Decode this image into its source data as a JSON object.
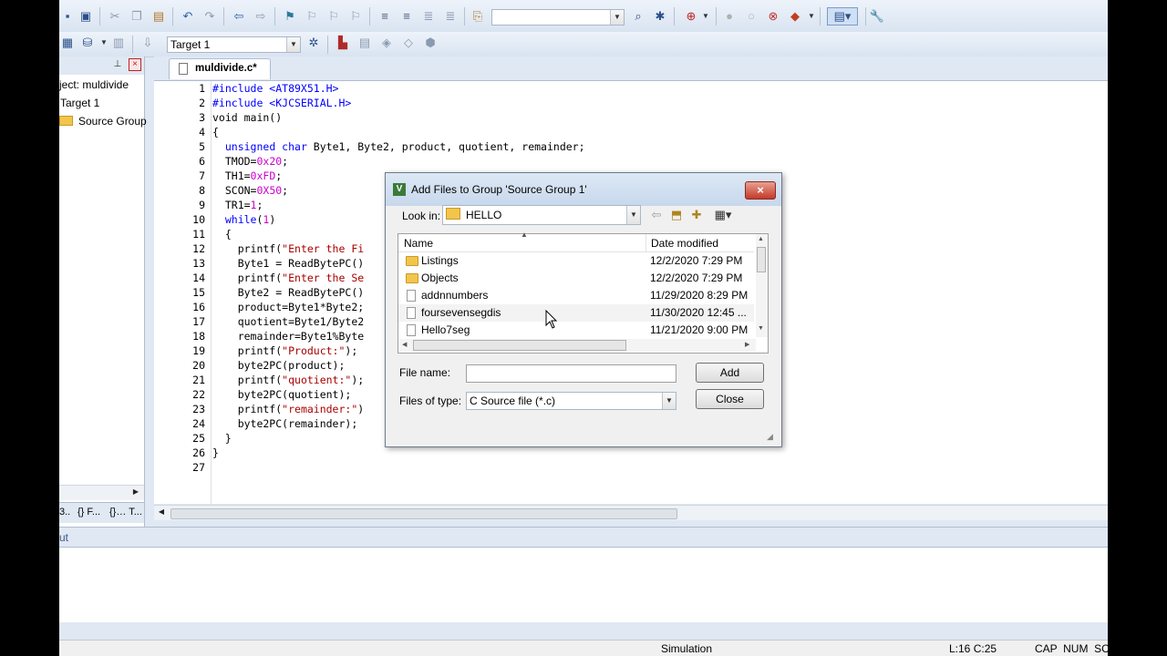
{
  "toolbar": {
    "target_value": "Target 1",
    "find_value": ""
  },
  "project": {
    "root_label": "ject: muldivide",
    "target_label": "Target 1",
    "group_label": "Source Group"
  },
  "left_tabs": [
    "3..",
    "{} F...",
    "{}… T..."
  ],
  "editor": {
    "tab_label": "muldivide.c*",
    "line_numbers": [
      "1",
      "2",
      "3",
      "4",
      "5",
      "6",
      "7",
      "8",
      "9",
      "10",
      "11",
      "12",
      "13",
      "14",
      "15",
      "16",
      "17",
      "18",
      "19",
      "20",
      "21",
      "22",
      "23",
      "24",
      "25",
      "26",
      "27"
    ]
  },
  "output_label": "ut",
  "status": {
    "mode": "Simulation",
    "position": "L:16 C:25",
    "indicators": "CAP  NUM  SCRL"
  },
  "dialog": {
    "title": "Add Files to Group 'Source Group 1'",
    "look_in_label": "Look in:",
    "look_in_value": "HELLO",
    "col_name": "Name",
    "col_date": "Date modified",
    "files": [
      {
        "name": "Listings",
        "date": "12/2/2020 7:29 PM",
        "type": "folder"
      },
      {
        "name": "Objects",
        "date": "12/2/2020 7:29 PM",
        "type": "folder"
      },
      {
        "name": "addnnumbers",
        "date": "11/29/2020 8:29 PM",
        "type": "file"
      },
      {
        "name": "foursevensegdis",
        "date": "11/30/2020 12:45 ...",
        "type": "file"
      },
      {
        "name": "Hello7seg",
        "date": "11/21/2020 9:00 PM",
        "type": "file"
      }
    ],
    "file_name_label": "File name:",
    "file_name_value": "",
    "file_type_label": "Files of type:",
    "file_type_value": "C Source file (*.c)",
    "add_label": "Add",
    "close_label": "Close"
  }
}
